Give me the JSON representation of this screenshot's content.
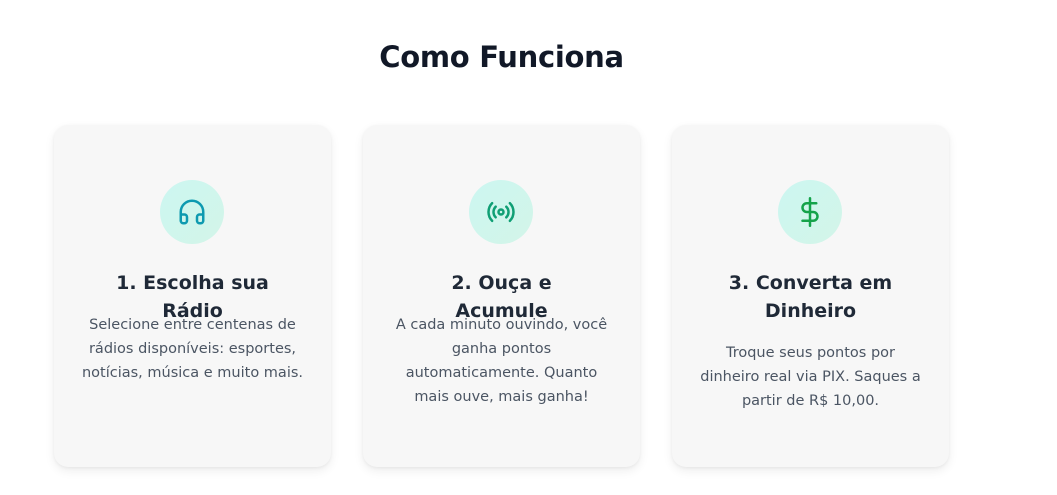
{
  "section": {
    "title": "Como Funciona"
  },
  "steps": [
    {
      "title": "1. Escolha sua Rádio",
      "description": "Selecione entre centenas de rádios disponíveis: esportes, notícias, música e muito mais.",
      "icon": "headphones-icon",
      "icon_color": "#0e9ab0"
    },
    {
      "title": "2. Ouça e Acumule",
      "description": "A cada minuto ouvindo, você ganha pontos automaticamente. Quanto mais ouve, mais ganha!",
      "icon": "broadcast-icon",
      "icon_color": "#0f9f74"
    },
    {
      "title": "3. Converta em Dinheiro",
      "description": "Troque seus pontos por dinheiro real via PIX. Saques a partir de R$ 10,00.",
      "icon": "dollar-sign-icon",
      "icon_color": "#14a34a"
    }
  ],
  "colors": {
    "card_background": "#f7f7f7",
    "icon_background": "#d0f6ee",
    "title_text": "#111827",
    "description_text": "#4b5563"
  }
}
